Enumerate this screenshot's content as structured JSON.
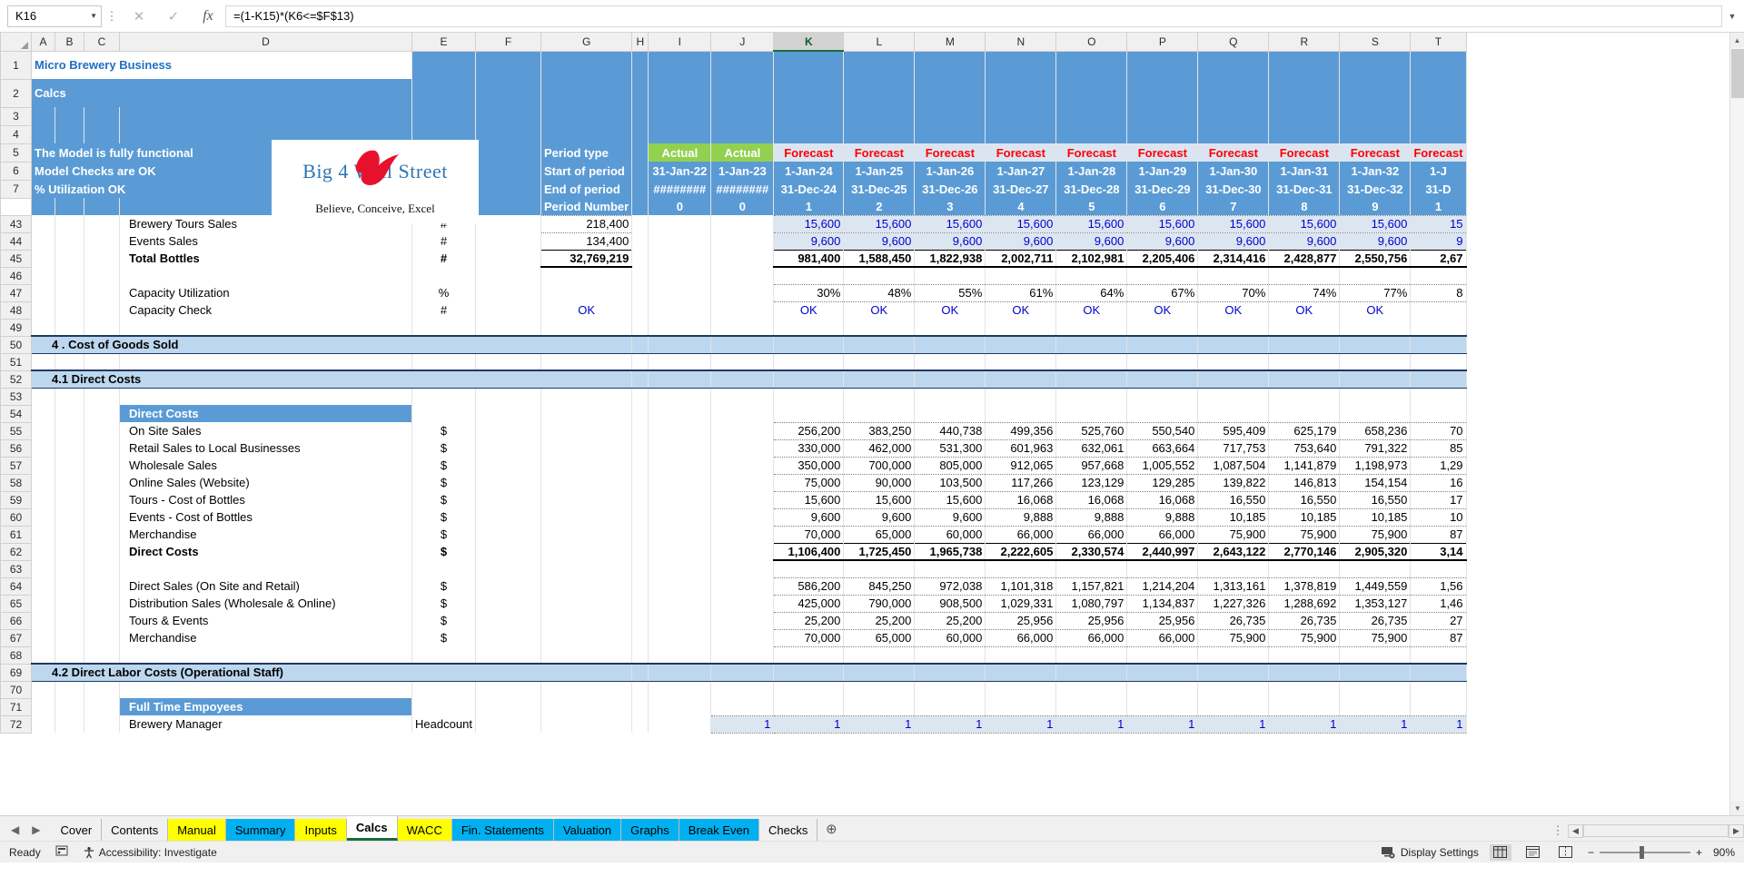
{
  "formula_bar": {
    "name_box": "K16",
    "formula": "=(1-K15)*(K6<=$F$13)",
    "cancel_icon": "x-icon",
    "confirm_icon": "check-icon",
    "fx_icon": "fx-icon"
  },
  "columns": [
    "A",
    "B",
    "C",
    "D",
    "E",
    "F",
    "G",
    "H",
    "I",
    "J",
    "K",
    "L",
    "M",
    "N",
    "O",
    "P",
    "Q",
    "R",
    "S",
    "T"
  ],
  "selected_column": "K",
  "title": {
    "line1": "Micro Brewery Business",
    "line2": "Calcs",
    "note1": "The Model is fully functional",
    "note2": "Model Checks are OK",
    "note3": "% Utilization OK"
  },
  "logo": {
    "text": "Big 4 Wall Street",
    "tagline": "Believe, Conceive, Excel"
  },
  "period_block": {
    "labels": [
      "Period type",
      "Start of period",
      "End of period",
      "Period Number"
    ],
    "period_type": [
      "Actual",
      "Actual",
      "Forecast",
      "Forecast",
      "Forecast",
      "Forecast",
      "Forecast",
      "Forecast",
      "Forecast",
      "Forecast",
      "Forecast",
      "Forecast"
    ],
    "start_of_period": [
      "31-Jan-22",
      "1-Jan-23",
      "1-Jan-24",
      "1-Jan-25",
      "1-Jan-26",
      "1-Jan-27",
      "1-Jan-28",
      "1-Jan-29",
      "1-Jan-30",
      "1-Jan-31",
      "1-Jan-32",
      "1-J"
    ],
    "end_of_period": [
      "########",
      "########",
      "31-Dec-24",
      "31-Dec-25",
      "31-Dec-26",
      "31-Dec-27",
      "31-Dec-28",
      "31-Dec-29",
      "31-Dec-30",
      "31-Dec-31",
      "31-Dec-32",
      "31-D"
    ],
    "period_number": [
      "0",
      "0",
      "1",
      "2",
      "3",
      "4",
      "5",
      "6",
      "7",
      "8",
      "9",
      "1"
    ]
  },
  "rows": [
    {
      "num": "43",
      "label": "Brewery Tours Sales",
      "unit": "#",
      "total": "218,400",
      "values": [
        "",
        "",
        "15,600",
        "15,600",
        "15,600",
        "15,600",
        "15,600",
        "15,600",
        "15,600",
        "15,600",
        "15,600",
        "15"
      ],
      "style": "blue"
    },
    {
      "num": "44",
      "label": "Events Sales",
      "unit": "#",
      "total": "134,400",
      "values": [
        "",
        "",
        "9,600",
        "9,600",
        "9,600",
        "9,600",
        "9,600",
        "9,600",
        "9,600",
        "9,600",
        "9,600",
        "9"
      ],
      "style": "blue"
    },
    {
      "num": "45",
      "label": "Total Bottles",
      "unit": "#",
      "total": "32,769,219",
      "values": [
        "",
        "",
        "981,400",
        "1,588,450",
        "1,822,938",
        "2,002,711",
        "2,102,981",
        "2,205,406",
        "2,314,416",
        "2,428,877",
        "2,550,756",
        "2,67"
      ],
      "style": "bold"
    },
    {
      "num": "46",
      "label": "",
      "unit": "",
      "total": "",
      "values": [
        "",
        "",
        "",
        "",
        "",
        "",
        "",
        "",
        "",
        "",
        "",
        ""
      ],
      "style": "empty"
    },
    {
      "num": "47",
      "label": "Capacity Utilization",
      "unit": "%",
      "total": "",
      "values": [
        "",
        "",
        "30%",
        "48%",
        "55%",
        "61%",
        "64%",
        "67%",
        "70%",
        "74%",
        "77%",
        "8"
      ],
      "style": "black"
    },
    {
      "num": "48",
      "label": "Capacity Check",
      "unit": "#",
      "total": "OK",
      "values": [
        "",
        "",
        "OK",
        "OK",
        "OK",
        "OK",
        "OK",
        "OK",
        "OK",
        "OK",
        "OK",
        ""
      ],
      "style": "ok"
    },
    {
      "num": "49",
      "label": "",
      "unit": "",
      "total": "",
      "values": [
        "",
        "",
        "",
        "",
        "",
        "",
        "",
        "",
        "",
        "",
        "",
        ""
      ],
      "style": "empty"
    },
    {
      "num": "50",
      "label": "4 . Cost of Goods Sold",
      "unit": "",
      "total": "",
      "values": [
        "",
        "",
        "",
        "",
        "",
        "",
        "",
        "",
        "",
        "",
        "",
        ""
      ],
      "style": "section"
    },
    {
      "num": "51",
      "label": "",
      "unit": "",
      "total": "",
      "values": [
        "",
        "",
        "",
        "",
        "",
        "",
        "",
        "",
        "",
        "",
        "",
        ""
      ],
      "style": "empty"
    },
    {
      "num": "52",
      "label": "4.1        Direct Costs",
      "unit": "",
      "total": "",
      "values": [
        "",
        "",
        "",
        "",
        "",
        "",
        "",
        "",
        "",
        "",
        "",
        ""
      ],
      "style": "section"
    },
    {
      "num": "53",
      "label": "",
      "unit": "",
      "total": "",
      "values": [
        "",
        "",
        "",
        "",
        "",
        "",
        "",
        "",
        "",
        "",
        "",
        ""
      ],
      "style": "empty-thin"
    },
    {
      "num": "54",
      "label": "Direct Costs",
      "unit": "",
      "total": "",
      "values": [
        "",
        "",
        "",
        "",
        "",
        "",
        "",
        "",
        "",
        "",
        "",
        ""
      ],
      "style": "bluelabel"
    },
    {
      "num": "55",
      "label": "On Site Sales",
      "unit": "$",
      "total": "",
      "values": [
        "",
        "",
        "256,200",
        "383,250",
        "440,738",
        "499,356",
        "525,760",
        "550,540",
        "595,409",
        "625,179",
        "658,236",
        "70"
      ],
      "style": "black"
    },
    {
      "num": "56",
      "label": "Retail Sales to Local Businesses",
      "unit": "$",
      "total": "",
      "values": [
        "",
        "",
        "330,000",
        "462,000",
        "531,300",
        "601,963",
        "632,061",
        "663,664",
        "717,753",
        "753,640",
        "791,322",
        "85"
      ],
      "style": "black"
    },
    {
      "num": "57",
      "label": "Wholesale Sales",
      "unit": "$",
      "total": "",
      "values": [
        "",
        "",
        "350,000",
        "700,000",
        "805,000",
        "912,065",
        "957,668",
        "1,005,552",
        "1,087,504",
        "1,141,879",
        "1,198,973",
        "1,29"
      ],
      "style": "black"
    },
    {
      "num": "58",
      "label": "Online Sales (Website)",
      "unit": "$",
      "total": "",
      "values": [
        "",
        "",
        "75,000",
        "90,000",
        "103,500",
        "117,266",
        "123,129",
        "129,285",
        "139,822",
        "146,813",
        "154,154",
        "16"
      ],
      "style": "black"
    },
    {
      "num": "59",
      "label": "Tours - Cost of Bottles",
      "unit": "$",
      "total": "",
      "values": [
        "",
        "",
        "15,600",
        "15,600",
        "15,600",
        "16,068",
        "16,068",
        "16,068",
        "16,550",
        "16,550",
        "16,550",
        "17"
      ],
      "style": "black"
    },
    {
      "num": "60",
      "label": "Events - Cost of Bottles",
      "unit": "$",
      "total": "",
      "values": [
        "",
        "",
        "9,600",
        "9,600",
        "9,600",
        "9,888",
        "9,888",
        "9,888",
        "10,185",
        "10,185",
        "10,185",
        "10"
      ],
      "style": "black"
    },
    {
      "num": "61",
      "label": "Merchandise",
      "unit": "$",
      "total": "",
      "values": [
        "",
        "",
        "70,000",
        "65,000",
        "60,000",
        "66,000",
        "66,000",
        "66,000",
        "75,900",
        "75,900",
        "75,900",
        "87"
      ],
      "style": "black"
    },
    {
      "num": "62",
      "label": "Direct Costs",
      "unit": "$",
      "total": "",
      "values": [
        "",
        "",
        "1,106,400",
        "1,725,450",
        "1,965,738",
        "2,222,605",
        "2,330,574",
        "2,440,997",
        "2,643,122",
        "2,770,146",
        "2,905,320",
        "3,14"
      ],
      "style": "bold"
    },
    {
      "num": "63",
      "label": "",
      "unit": "",
      "total": "",
      "values": [
        "",
        "",
        "",
        "",
        "",
        "",
        "",
        "",
        "",
        "",
        "",
        ""
      ],
      "style": "empty"
    },
    {
      "num": "64",
      "label": "Direct Sales (On Site and Retail)",
      "unit": "$",
      "total": "",
      "values": [
        "",
        "",
        "586,200",
        "845,250",
        "972,038",
        "1,101,318",
        "1,157,821",
        "1,214,204",
        "1,313,161",
        "1,378,819",
        "1,449,559",
        "1,56"
      ],
      "style": "black"
    },
    {
      "num": "65",
      "label": "Distribution Sales (Wholesale & Online)",
      "unit": "$",
      "total": "",
      "values": [
        "",
        "",
        "425,000",
        "790,000",
        "908,500",
        "1,029,331",
        "1,080,797",
        "1,134,837",
        "1,227,326",
        "1,288,692",
        "1,353,127",
        "1,46"
      ],
      "style": "black"
    },
    {
      "num": "66",
      "label": "Tours & Events",
      "unit": "$",
      "total": "",
      "values": [
        "",
        "",
        "25,200",
        "25,200",
        "25,200",
        "25,956",
        "25,956",
        "25,956",
        "26,735",
        "26,735",
        "26,735",
        "27"
      ],
      "style": "black"
    },
    {
      "num": "67",
      "label": "Merchandise",
      "unit": "$",
      "total": "",
      "values": [
        "",
        "",
        "70,000",
        "65,000",
        "60,000",
        "66,000",
        "66,000",
        "66,000",
        "75,900",
        "75,900",
        "75,900",
        "87"
      ],
      "style": "black"
    },
    {
      "num": "68",
      "label": "",
      "unit": "",
      "total": "",
      "values": [
        "",
        "",
        "",
        "",
        "",
        "",
        "",
        "",
        "",
        "",
        "",
        ""
      ],
      "style": "empty"
    },
    {
      "num": "69",
      "label": "4.2        Direct Labor Costs (Operational Staff)",
      "unit": "",
      "total": "",
      "values": [
        "",
        "",
        "",
        "",
        "",
        "",
        "",
        "",
        "",
        "",
        "",
        ""
      ],
      "style": "section"
    },
    {
      "num": "70",
      "label": "",
      "unit": "",
      "total": "",
      "values": [
        "",
        "",
        "",
        "",
        "",
        "",
        "",
        "",
        "",
        "",
        "",
        ""
      ],
      "style": "empty"
    },
    {
      "num": "71",
      "label": "Full Time Empoyees",
      "unit": "",
      "total": "",
      "values": [
        "",
        "",
        "",
        "",
        "",
        "",
        "",
        "",
        "",
        "",
        "",
        ""
      ],
      "style": "bluelabel"
    },
    {
      "num": "72",
      "label": "Brewery Manager",
      "unit": "Headcount",
      "total": "",
      "values": [
        "",
        "1",
        "1",
        "1",
        "1",
        "1",
        "1",
        "1",
        "1",
        "1",
        "1",
        "1"
      ],
      "style": "blue"
    }
  ],
  "sheet_tabs": [
    {
      "label": "Cover",
      "color": "plain"
    },
    {
      "label": "Contents",
      "color": "plain"
    },
    {
      "label": "Manual",
      "color": "yellow"
    },
    {
      "label": "Summary",
      "color": "cyan"
    },
    {
      "label": "Inputs",
      "color": "yellow"
    },
    {
      "label": "Calcs",
      "color": "active"
    },
    {
      "label": "WACC",
      "color": "yellow"
    },
    {
      "label": "Fin. Statements",
      "color": "cyan"
    },
    {
      "label": "Valuation",
      "color": "cyan"
    },
    {
      "label": "Graphs",
      "color": "cyan"
    },
    {
      "label": "Break Even",
      "color": "cyan"
    },
    {
      "label": "Checks",
      "color": "plain"
    }
  ],
  "tab_nav": {
    "prev_icon": "chevron-left-icon",
    "next_icon": "chevron-right-icon",
    "add_icon": "plus-circle-icon"
  },
  "status_bar": {
    "state": "Ready",
    "macro_icon": "record-macro-icon",
    "accessibility_icon": "accessibility-icon",
    "accessibility": "Accessibility: Investigate",
    "display_settings_icon": "display-settings-icon",
    "display_settings": "Display Settings",
    "view_normal_icon": "normal-view-icon",
    "view_pagelayout_icon": "page-layout-view-icon",
    "view_pagebreak_icon": "page-break-view-icon",
    "zoom_out_icon": "minus-icon",
    "zoom_in_icon": "plus-icon",
    "zoom_level": "90%"
  },
  "colors": {
    "header_blue": "#5b9bd5",
    "actual_green": "#92d050",
    "forecast_red": "#ff0000",
    "section_blue": "#bdd7ee",
    "input_blue": "#0000cc",
    "tab_yellow": "#ffff00",
    "tab_cyan": "#00b0f0"
  }
}
